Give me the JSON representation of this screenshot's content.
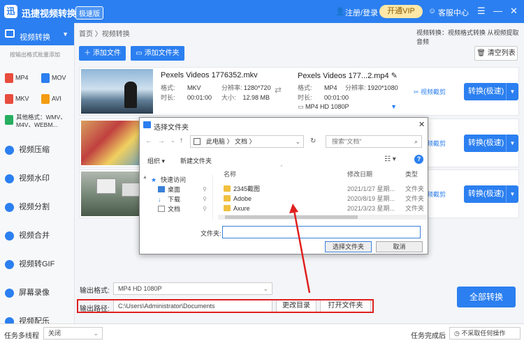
{
  "app": {
    "logo_char": "迅",
    "title": "迅捷视频转换器",
    "edition_badge": "极速版"
  },
  "topbar": {
    "register_login": "注册/登录",
    "vip": "开通VIP",
    "service": "客服中心",
    "menu_icon": "menu-icon",
    "minimize": "—",
    "close": "✕"
  },
  "sidebar": {
    "main_item": "视频转换",
    "batch_hint": "按输出格式批量添加",
    "formats": [
      "MP4",
      "MOV",
      "MKV",
      "AVI"
    ],
    "other_formats": "其他格式：WMV、M4V、WEBM...",
    "items": [
      "视频压缩",
      "视频水印",
      "视频分割",
      "视频合并",
      "视频转GIF",
      "屏幕录像",
      "视频配乐"
    ]
  },
  "breadcrumb": "首页 〉视频转换",
  "right_hint": "视频转换：视频格式转换 从视频提取音频",
  "toolbar": {
    "add_file": "添加文件",
    "add_folder": "添加文件夹",
    "clear_list": "清空列表"
  },
  "files": [
    {
      "name": "Pexels Videos 1776352.mkv",
      "format_label": "格式:",
      "format": "MKV",
      "res_label": "分辨率:",
      "resolution": "1280*720",
      "duration_label": "时长:",
      "duration": "00:01:00",
      "size_label": "大小:",
      "size": "12.98 MB",
      "out_name": "Pexels Videos 177...2.mp4",
      "out_format_label": "格式:",
      "out_format": "MP4",
      "out_res_label": "分辨率:",
      "out_resolution": "1920*1080",
      "out_duration_label": "时长:",
      "out_duration": "00:01:00",
      "out_preset": "MP4   HD 1080P",
      "cut": "视频截剪",
      "convert": "转换(极速)"
    },
    {
      "cut": "视频截剪",
      "convert": "转换(极速)"
    },
    {
      "cut": "视频截剪",
      "convert": "转换(极速)"
    }
  ],
  "bottom": {
    "output_format_label": "输出格式:",
    "output_format": "MP4   HD 1080P",
    "output_path_label": "输出路径:",
    "output_path": "C:\\Users\\Administrator\\Documents",
    "change_dir": "更改目录",
    "open_folder": "打开文件夹",
    "convert_all": "全部转换"
  },
  "status": {
    "multithread_label": "任务多线程",
    "multithread_value": "关闭",
    "on_done_label": "任务完成后",
    "on_done_value": "不采取任何操作"
  },
  "dialog": {
    "title": "选择文件夹",
    "address": [
      "此电脑",
      "文档"
    ],
    "search_placeholder": "搜索\"文档\"",
    "organize": "组织 ▾",
    "new_folder": "新建文件夹",
    "nav": [
      "快速访问",
      "桌面",
      "下载",
      "文档"
    ],
    "columns": {
      "name": "名称",
      "modified": "修改日期",
      "type": "类型"
    },
    "rows": [
      {
        "name": "2345截图",
        "date": "2021/1/27 星期...",
        "type": "文件夹"
      },
      {
        "name": "Adobe",
        "date": "2020/8/19 星期...",
        "type": "文件夹"
      },
      {
        "name": "Axure",
        "date": "2021/3/23 星期...",
        "type": "文件夹"
      }
    ],
    "folder_label": "文件夹:",
    "select_button": "选择文件夹",
    "cancel_button": "取消"
  },
  "colors": {
    "accent": "#2b7ff0",
    "highlight": "#e02020"
  }
}
